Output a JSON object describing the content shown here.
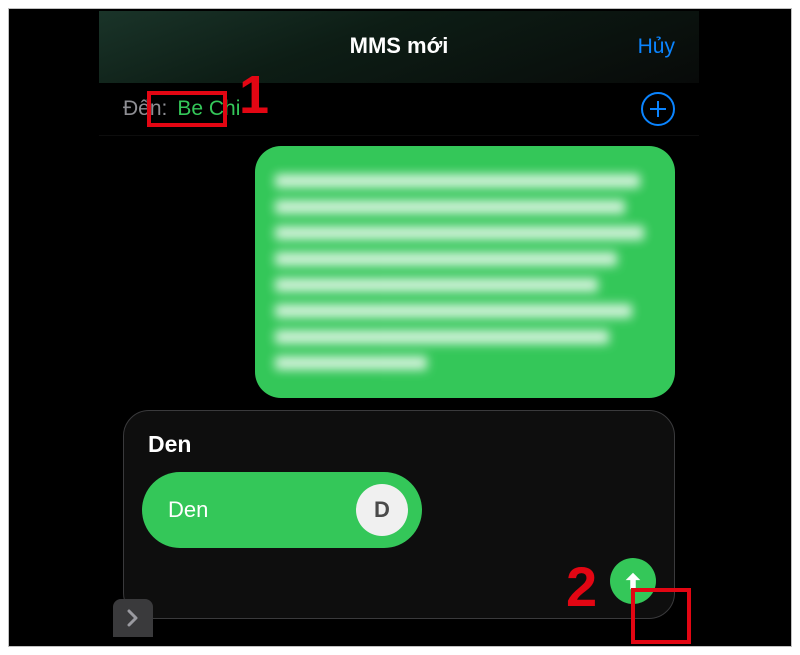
{
  "header": {
    "title": "MMS mới",
    "cancel": "Hủy"
  },
  "to": {
    "label": "Đến:",
    "value": "Be Chi"
  },
  "contact_card": {
    "title": "Den",
    "chip_name": "Den",
    "avatar_initial": "D"
  },
  "annotations": {
    "one": "1",
    "two": "2"
  }
}
